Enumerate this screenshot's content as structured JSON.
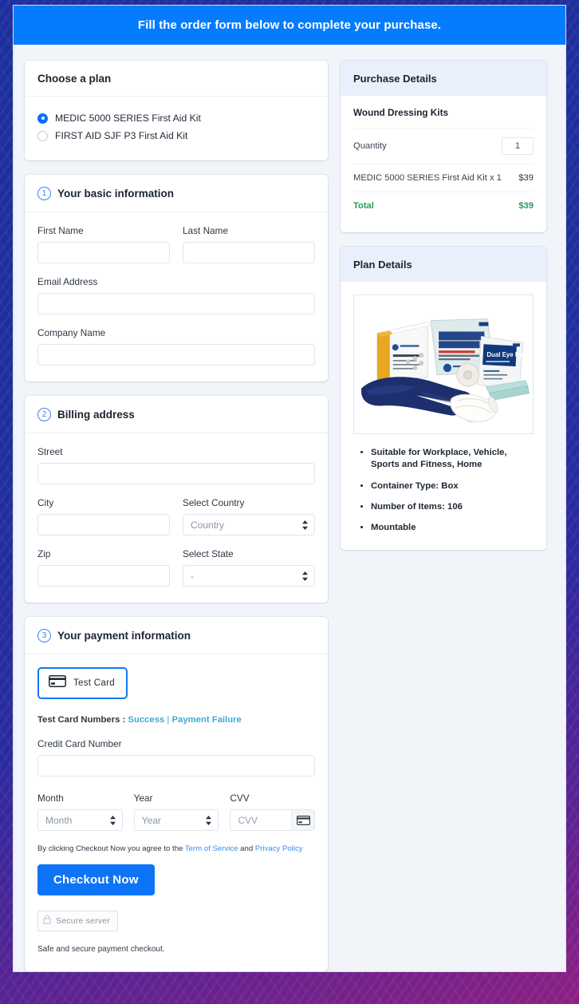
{
  "header": {
    "title": "Fill the order form below to complete your purchase."
  },
  "plan": {
    "heading": "Choose a plan",
    "options": [
      {
        "label": "MEDIC 5000 SERIES First Aid Kit",
        "selected": true
      },
      {
        "label": "FIRST AID SJF P3 First Aid Kit",
        "selected": false
      }
    ]
  },
  "basic": {
    "step": "1",
    "heading": "Your basic information",
    "first_name_label": "First Name",
    "first_name_value": "",
    "last_name_label": "Last Name",
    "last_name_value": "",
    "email_label": "Email Address",
    "email_value": "",
    "company_label": "Company Name",
    "company_value": ""
  },
  "billing": {
    "step": "2",
    "heading": "Billing address",
    "street_label": "Street",
    "street_value": "",
    "city_label": "City",
    "city_value": "",
    "country_label": "Select Country",
    "country_value": "Country",
    "zip_label": "Zip",
    "zip_value": "",
    "state_label": "Select State",
    "state_value": "-"
  },
  "payment": {
    "step": "3",
    "heading": "Your payment information",
    "card_tab_label": "Test  Card",
    "test_numbers_label": "Test Card Numbers : ",
    "test_success_link": "Success",
    "test_separator": " | ",
    "test_failure_link": "Payment Failure",
    "cc_label": "Credit Card Number",
    "cc_value": "",
    "month_label": "Month",
    "month_value": "Month",
    "year_label": "Year",
    "year_value": "Year",
    "cvv_label": "CVV",
    "cvv_placeholder": "CVV",
    "agree_prefix": "By clicking Checkout Now you agree to the ",
    "terms_link": "Term of Service",
    "agree_join": " and ",
    "privacy_link": "Privacy Policy",
    "checkout_label": "Checkout Now",
    "secure_badge": "Secure server",
    "safe_note": "Safe and secure payment checkout."
  },
  "purchase": {
    "heading": "Purchase Details",
    "product_title": "Wound Dressing Kits",
    "quantity_label": "Quantity",
    "quantity_value": "1",
    "line_item_label": "MEDIC 5000 SERIES First Aid Kit x 1",
    "line_item_amount": "$39",
    "total_label": "Total",
    "total_amount": "$39"
  },
  "plan_details": {
    "heading": "Plan Details",
    "image_alt": "first-aid-kit-contents-photo",
    "features": [
      "Suitable for Workplace, Vehicle, Sports and Fitness, Home",
      "Container Type: Box",
      "Number of Items: 106",
      "Mountable"
    ]
  },
  "colors": {
    "accent_blue": "#057bfd",
    "button_blue": "#0d74f7",
    "total_green": "#22a05a",
    "link_teal": "#3fa9d8",
    "panel_head_bg": "#e9f0fb"
  }
}
